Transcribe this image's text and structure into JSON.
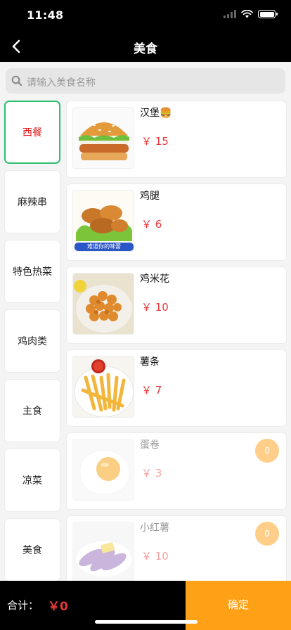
{
  "status": {
    "time": "11:48"
  },
  "nav": {
    "title": "美食",
    "back_icon": "chevron-left-icon"
  },
  "search": {
    "placeholder": "请输入美食名称",
    "icon": "search-icon"
  },
  "categories": [
    {
      "label": "西餐",
      "active": true
    },
    {
      "label": "麻辣串",
      "active": false
    },
    {
      "label": "特色热菜",
      "active": false
    },
    {
      "label": "鸡肉类",
      "active": false
    },
    {
      "label": "主食",
      "active": false
    },
    {
      "label": "凉菜",
      "active": false
    },
    {
      "label": "美食",
      "active": false
    }
  ],
  "foods": [
    {
      "name": "汉堡🍔",
      "price": "￥ 15",
      "image": "burger",
      "dim": false
    },
    {
      "name": "鸡腿",
      "price": "￥ 6",
      "image": "chicken-legs",
      "caption": "难道你的味蕾",
      "dim": false
    },
    {
      "name": "鸡米花",
      "price": "￥ 10",
      "image": "popcorn-chicken",
      "dim": false
    },
    {
      "name": "薯条",
      "price": "￥ 7",
      "image": "french-fries",
      "dim": false
    },
    {
      "name": "蛋卷",
      "price": "￥ 3",
      "image": "fried-egg",
      "dim": true,
      "count": "0"
    },
    {
      "name": "小红薯",
      "price": "￥ 10",
      "image": "sweet-potato",
      "dim": true,
      "count": "0"
    }
  ],
  "footer": {
    "total_label": "合计：",
    "total_value": "￥0",
    "confirm_label": "确定"
  },
  "colors": {
    "accent": "#ffa117",
    "price": "#e5383b",
    "active_border": "#2fbf6f",
    "badge": "#ffcf8a"
  }
}
